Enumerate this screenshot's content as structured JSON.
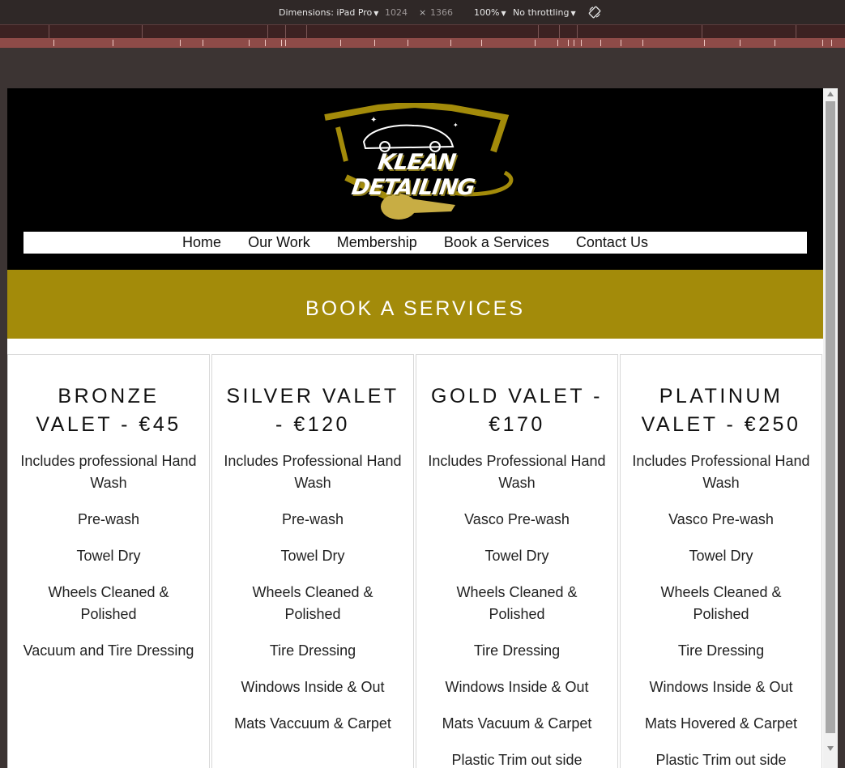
{
  "devtools": {
    "dimensions_label": "Dimensions: iPad Pro",
    "width_value": "1024",
    "times": "×",
    "height_value": "1366",
    "zoom": "100%",
    "throttling": "No throttling"
  },
  "site": {
    "logo_text": "KLEAN DETAILING",
    "nav": [
      "Home",
      "Our Work",
      "Membership",
      "Book a Services",
      "Contact Us"
    ],
    "banner_title": "BOOK A SERVICES",
    "cards": [
      {
        "title": "BRONZE VALET - €45",
        "items": [
          "Includes professional Hand Wash",
          "Pre-wash",
          "Towel Dry",
          "Wheels Cleaned & Polished",
          "Vacuum and Tire Dressing"
        ]
      },
      {
        "title": "SILVER VALET - €120",
        "items": [
          "Includes Professional Hand Wash",
          "Pre-wash",
          "Towel Dry",
          "Wheels Cleaned & Polished",
          "Tire Dressing",
          "Windows Inside & Out",
          "Mats Vaccuum & Carpet"
        ]
      },
      {
        "title": "GOLD VALET - €170",
        "items": [
          "Includes Professional Hand Wash",
          "Vasco Pre-wash",
          "Towel Dry",
          "Wheels Cleaned & Polished",
          "Tire Dressing",
          "Windows Inside & Out",
          "Mats Vacuum & Carpet",
          "Plastic Trim out side"
        ]
      },
      {
        "title": "PLATINUM VALET - €250",
        "items": [
          "Includes Professional Hand Wash",
          "Vasco Pre-wash",
          "Towel Dry",
          "Wheels Cleaned & Polished",
          "Tire Dressing",
          "Windows Inside & Out",
          "Mats Hovered & Carpet",
          "Plastic Trim out side"
        ]
      }
    ]
  },
  "colors": {
    "brand_gold": "#a38b0a",
    "header_bg": "#000000",
    "devtools_bg": "#2f2827"
  }
}
